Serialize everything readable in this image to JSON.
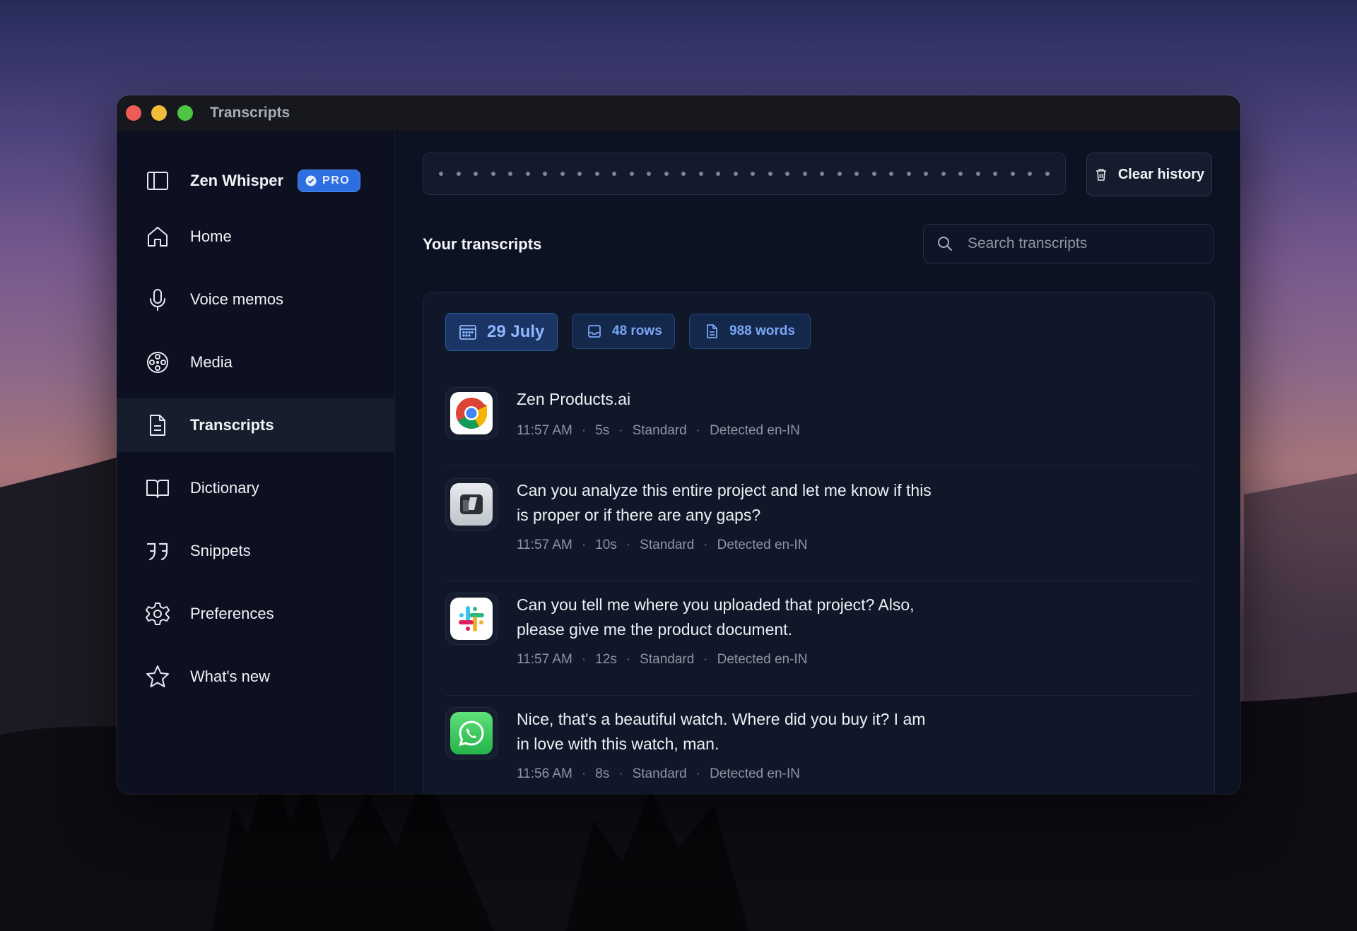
{
  "window": {
    "title": "Transcripts"
  },
  "sidebar": {
    "brand": {
      "name": "Zen Whisper",
      "badge": "PRO",
      "icon": "sidebar-toggle-icon"
    },
    "items": [
      {
        "label": "Home",
        "icon": "home-icon"
      },
      {
        "label": "Voice memos",
        "icon": "microphone-icon"
      },
      {
        "label": "Media",
        "icon": "film-reel-icon"
      },
      {
        "label": "Transcripts",
        "icon": "document-icon",
        "active": true
      },
      {
        "label": "Dictionary",
        "icon": "book-icon"
      },
      {
        "label": "Snippets",
        "icon": "quote-icon"
      },
      {
        "label": "Preferences",
        "icon": "gear-icon"
      },
      {
        "label": "What's new",
        "icon": "star-icon"
      }
    ]
  },
  "toolbar": {
    "clear_label": "Clear history"
  },
  "main": {
    "section_title": "Your transcripts",
    "search": {
      "placeholder": "Search transcripts"
    },
    "chips": {
      "date": "29 July",
      "rows": "48 rows",
      "words": "988 words"
    },
    "entries": [
      {
        "app": "chrome",
        "text": "Zen Products.ai",
        "time": "11:57 AM",
        "duration": "5s",
        "mode": "Standard",
        "lang": "Detected en-IN"
      },
      {
        "app": "terminal",
        "text": "Can you analyze this entire project and let me know if this is proper or if there are any gaps?",
        "time": "11:57 AM",
        "duration": "10s",
        "mode": "Standard",
        "lang": "Detected en-IN"
      },
      {
        "app": "slack",
        "text": "Can you tell me where you uploaded that project? Also, please give me the product document.",
        "time": "11:57 AM",
        "duration": "12s",
        "mode": "Standard",
        "lang": "Detected en-IN"
      },
      {
        "app": "whatsapp",
        "text": "Nice, that's a beautiful watch. Where did you buy it? I am in love with this watch, man.",
        "time": "11:56 AM",
        "duration": "8s",
        "mode": "Standard",
        "lang": "Detected en-IN"
      }
    ]
  },
  "colors": {
    "accent": "#2d6ee0",
    "window_bg": "#0c1222",
    "chip_text": "#7aa6f5"
  }
}
